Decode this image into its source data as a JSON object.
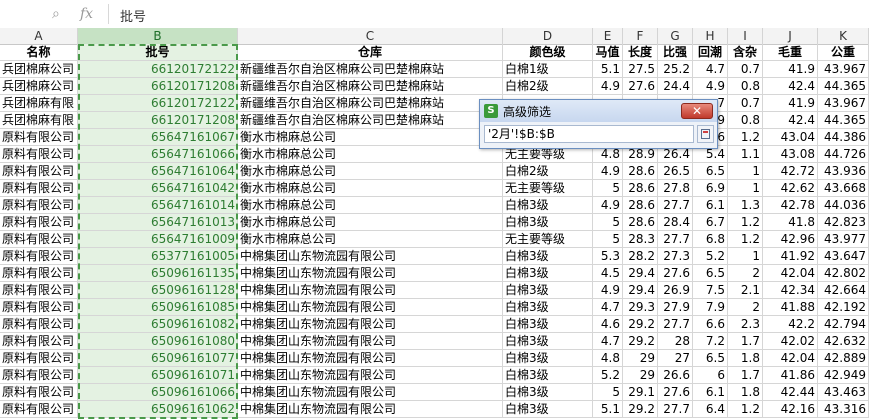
{
  "formula_bar": {
    "zoom_icon": "magnifier-icon",
    "fx_label": "fx",
    "content": "批号"
  },
  "columns": [
    {
      "letter": "A",
      "selected": false
    },
    {
      "letter": "B",
      "selected": true
    },
    {
      "letter": "C",
      "selected": false
    },
    {
      "letter": "D",
      "selected": false
    },
    {
      "letter": "E",
      "selected": false
    },
    {
      "letter": "F",
      "selected": false
    },
    {
      "letter": "G",
      "selected": false
    },
    {
      "letter": "H",
      "selected": false
    },
    {
      "letter": "I",
      "selected": false
    },
    {
      "letter": "J",
      "selected": false
    },
    {
      "letter": "K",
      "selected": false
    }
  ],
  "table": {
    "headers": [
      "名称",
      "批号",
      "仓库",
      "颜色级",
      "马值",
      "长度",
      "比强",
      "回潮",
      "含杂",
      "毛重",
      "公重"
    ],
    "rows": [
      [
        "兵团棉麻公司",
        "66120172122",
        "新疆维吾尔自治区棉麻公司巴楚棉麻站",
        "白棉1级",
        "5.1",
        "27.5",
        "25.2",
        "4.7",
        "0.7",
        "41.9",
        "43.967"
      ],
      [
        "兵团棉麻公司",
        "66120171208",
        "新疆维吾尔自治区棉麻公司巴楚棉麻站",
        "白棉2级",
        "4.9",
        "27.6",
        "24.4",
        "4.9",
        "0.8",
        "42.4",
        "44.365"
      ],
      [
        "兵团棉麻有限",
        "66120172122",
        "新疆维吾尔自治区棉麻公司巴楚棉麻站",
        "",
        "",
        "",
        "",
        "7",
        "0.7",
        "41.9",
        "43.967"
      ],
      [
        "兵团棉麻有限",
        "66120171208",
        "新疆维吾尔自治区棉麻公司巴楚棉麻站",
        "",
        "",
        "",
        "",
        "9",
        "0.8",
        "42.4",
        "44.365"
      ],
      [
        "原料有限公司",
        "65647161067",
        "衡水市棉麻总公司",
        "",
        "",
        "",
        "",
        "6",
        "1.2",
        "43.04",
        "44.386"
      ],
      [
        "原料有限公司",
        "65647161066",
        "衡水市棉麻总公司",
        "无主要等级",
        "4.8",
        "28.9",
        "26.4",
        "5.4",
        "1.1",
        "43.08",
        "44.726"
      ],
      [
        "原料有限公司",
        "65647161064",
        "衡水市棉麻总公司",
        "白棉2级",
        "4.9",
        "28.6",
        "26.5",
        "6.5",
        "1",
        "42.72",
        "43.936"
      ],
      [
        "原料有限公司",
        "65647161042",
        "衡水市棉麻总公司",
        "无主要等级",
        "5",
        "28.6",
        "27.8",
        "6.9",
        "1",
        "42.62",
        "43.668"
      ],
      [
        "原料有限公司",
        "65647161014",
        "衡水市棉麻总公司",
        "白棉3级",
        "4.9",
        "28.6",
        "27.7",
        "6.1",
        "1.3",
        "42.78",
        "44.036"
      ],
      [
        "原料有限公司",
        "65647161013",
        "衡水市棉麻总公司",
        "白棉3级",
        "5",
        "28.6",
        "28.4",
        "6.7",
        "1.2",
        "41.8",
        "42.823"
      ],
      [
        "原料有限公司",
        "65647161009",
        "衡水市棉麻总公司",
        "无主要等级",
        "5",
        "28.3",
        "27.7",
        "6.8",
        "1.2",
        "42.96",
        "43.977"
      ],
      [
        "原料有限公司",
        "65377161005",
        "中棉集团山东物流园有限公司",
        "白棉3级",
        "5.3",
        "28.2",
        "27.3",
        "5.2",
        "1",
        "41.92",
        "43.647"
      ],
      [
        "原料有限公司",
        "65096161135",
        "中棉集团山东物流园有限公司",
        "白棉3级",
        "4.5",
        "29.4",
        "27.6",
        "6.5",
        "2",
        "42.04",
        "42.802"
      ],
      [
        "原料有限公司",
        "65096161128",
        "中棉集团山东物流园有限公司",
        "白棉3级",
        "4.9",
        "29.4",
        "26.9",
        "7.5",
        "2.1",
        "42.34",
        "42.664"
      ],
      [
        "原料有限公司",
        "65096161085",
        "中棉集团山东物流园有限公司",
        "白棉3级",
        "4.7",
        "29.3",
        "27.9",
        "7.9",
        "2",
        "41.88",
        "42.192"
      ],
      [
        "原料有限公司",
        "65096161082",
        "中棉集团山东物流园有限公司",
        "白棉3级",
        "4.6",
        "29.2",
        "27.7",
        "6.6",
        "2.3",
        "42.2",
        "42.794"
      ],
      [
        "原料有限公司",
        "65096161080",
        "中棉集团山东物流园有限公司",
        "白棉3级",
        "4.7",
        "29.2",
        "28",
        "7.2",
        "1.7",
        "42.02",
        "42.632"
      ],
      [
        "原料有限公司",
        "65096161077",
        "中棉集团山东物流园有限公司",
        "白棉3级",
        "4.8",
        "29",
        "27",
        "6.5",
        "1.8",
        "42.04",
        "42.889"
      ],
      [
        "原料有限公司",
        "65096161071",
        "中棉集团山东物流园有限公司",
        "白棉3级",
        "5.2",
        "29",
        "26.6",
        "6",
        "1.7",
        "41.86",
        "42.949"
      ],
      [
        "原料有限公司",
        "65096161066",
        "中棉集团山东物流园有限公司",
        "白棉3级",
        "5",
        "29.1",
        "27.6",
        "6.1",
        "1.8",
        "42.44",
        "43.463"
      ],
      [
        "原料有限公司",
        "65096161062",
        "中棉集团山东物流园有限公司",
        "白棉3级",
        "5.1",
        "29.2",
        "27.7",
        "6.4",
        "1.2",
        "42.16",
        "43.316"
      ]
    ]
  },
  "dialog": {
    "app_icon_letter": "S",
    "title": "高级筛选",
    "close_label": "✕",
    "input_value": "'2月'!$B:$B"
  }
}
